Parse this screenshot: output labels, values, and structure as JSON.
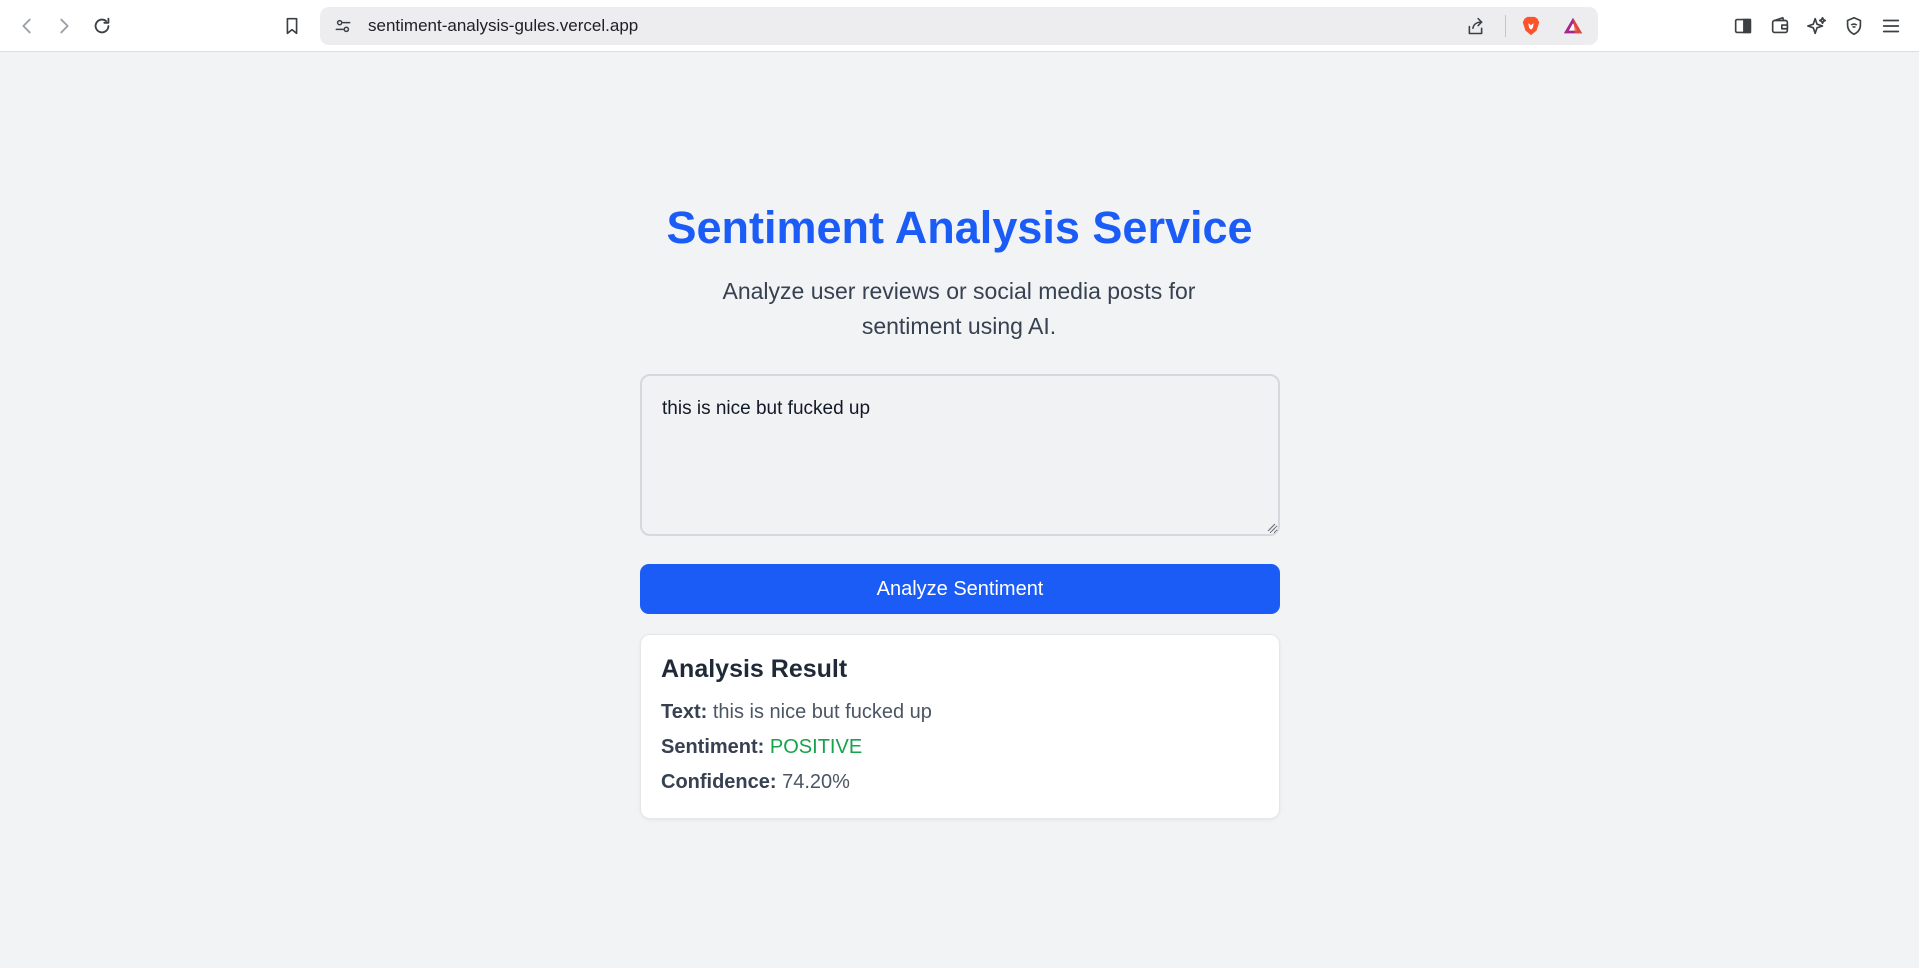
{
  "browser": {
    "url": "sentiment-analysis-gules.vercel.app",
    "icons": {
      "back": "back-arrow-icon",
      "forward": "forward-arrow-icon",
      "reload": "reload-icon",
      "bookmark": "bookmark-icon",
      "site_settings": "site-settings-icon",
      "share": "share-icon",
      "brave_shields": "brave-lion-icon",
      "brave_rewards": "rewards-triangle-icon",
      "sidebar": "sidebar-icon",
      "wallet": "wallet-icon",
      "leo": "leo-ai-icon",
      "vpn": "vpn-shield-icon",
      "menu": "hamburger-menu-icon"
    }
  },
  "page": {
    "title": "Sentiment Analysis Service",
    "subtitle": "Analyze user reviews or social media posts for sentiment using AI."
  },
  "form": {
    "input_value": "this is nice but fucked up",
    "submit_label": "Analyze Sentiment"
  },
  "result": {
    "heading": "Analysis Result",
    "text_label": "Text:",
    "text_value": "this is nice but fucked up",
    "sentiment_label": "Sentiment:",
    "sentiment_value": "POSITIVE",
    "confidence_label": "Confidence:",
    "confidence_value": "74.20%"
  },
  "colors": {
    "accent": "#1a5cf5",
    "positive": "#16a34a",
    "background": "#f2f3f5"
  }
}
